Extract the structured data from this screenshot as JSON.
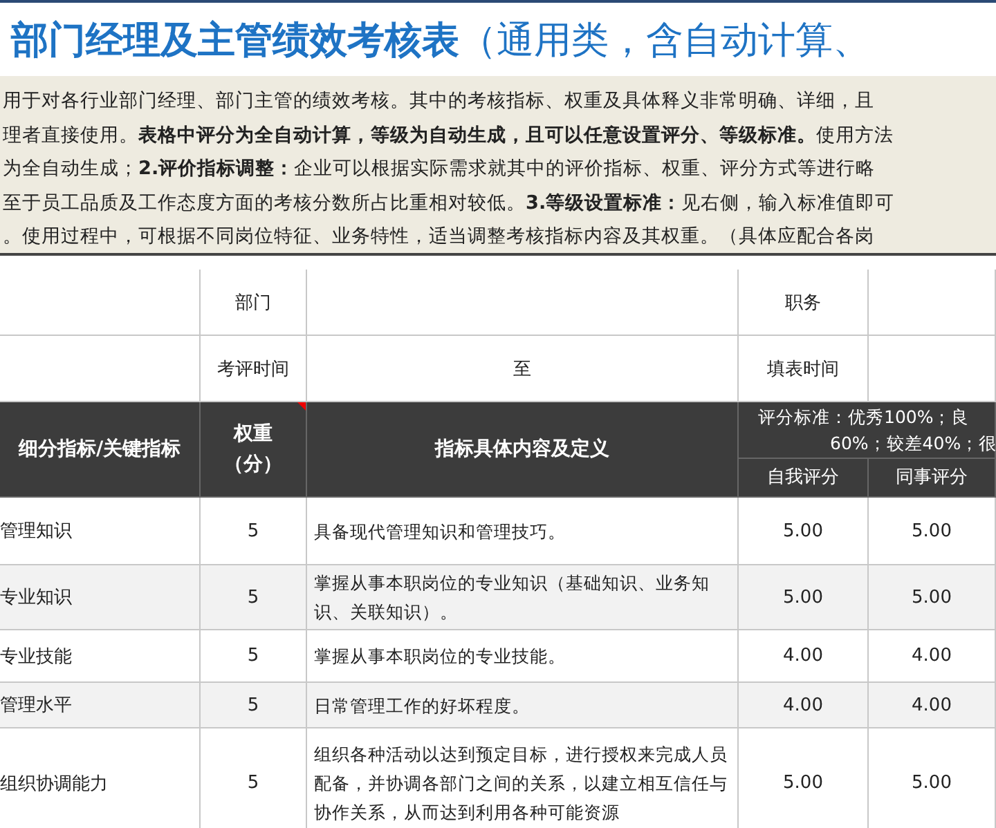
{
  "title": {
    "main": "部门经理及主管绩效考核表",
    "sub": "（通用类，含自动计算、"
  },
  "notice": [
    "用于对各行业部门经理、部门主管的绩效考核。其中的考核指标、权重及具体释义非常明确、详细，且",
    "理者直接使用。**表格中评分为全自动计算，等级为自动生成，且可以任意设置评分、等级标准。**使用方法",
    "为全自动生成；**2.评价指标调整：**企业可以根据实际需求就其中的评价指标、权重、评分方式等进行略",
    "至于员工品质及工作态度方面的考核分数所占比重相对较低。**3.等级设置标准：**见右侧，输入标准值即可",
    "。使用过程中，可根据不同岗位特征、业务特性，适当调整考核指标内容及其权重。（具体应配合各岗"
  ],
  "info_rows": [
    {
      "label": "部门",
      "middle": "",
      "label2": "职务"
    },
    {
      "label": "考评时间",
      "middle": "至",
      "label2": "填表时间"
    }
  ],
  "header": {
    "indicator": "细分指标/关键指标",
    "weight": [
      "权重",
      "（分）"
    ],
    "definition": "指标具体内容及定义",
    "standard": [
      "评分标准：优秀100%；良",
      "60%；较差40%；很"
    ],
    "self": "自我评分",
    "peer": "同事评分"
  },
  "rows": [
    {
      "indicator": "管理知识",
      "weight": "5",
      "definition": "具备现代管理知识和管理技巧。",
      "self": "5.00",
      "peer": "5.00"
    },
    {
      "indicator": "专业知识",
      "weight": "5",
      "definition": "掌握从事本职岗位的专业知识（基础知识、业务知识、关联知识）。",
      "self": "5.00",
      "peer": "5.00"
    },
    {
      "indicator": "专业技能",
      "weight": "5",
      "definition": "掌握从事本职岗位的专业技能。",
      "self": "4.00",
      "peer": "4.00"
    },
    {
      "indicator": "管理水平",
      "weight": "5",
      "definition": "日常管理工作的好坏程度。",
      "self": "4.00",
      "peer": "4.00"
    },
    {
      "indicator": "组织协调能力",
      "weight": "5",
      "definition": "组织各种活动以达到预定目标，进行授权来完成人员配备，并协调各部门之间的关系，以建立相互信任与协作关系，从而达到利用各种可能资源",
      "self": "5.00",
      "peer": "5.00"
    }
  ]
}
